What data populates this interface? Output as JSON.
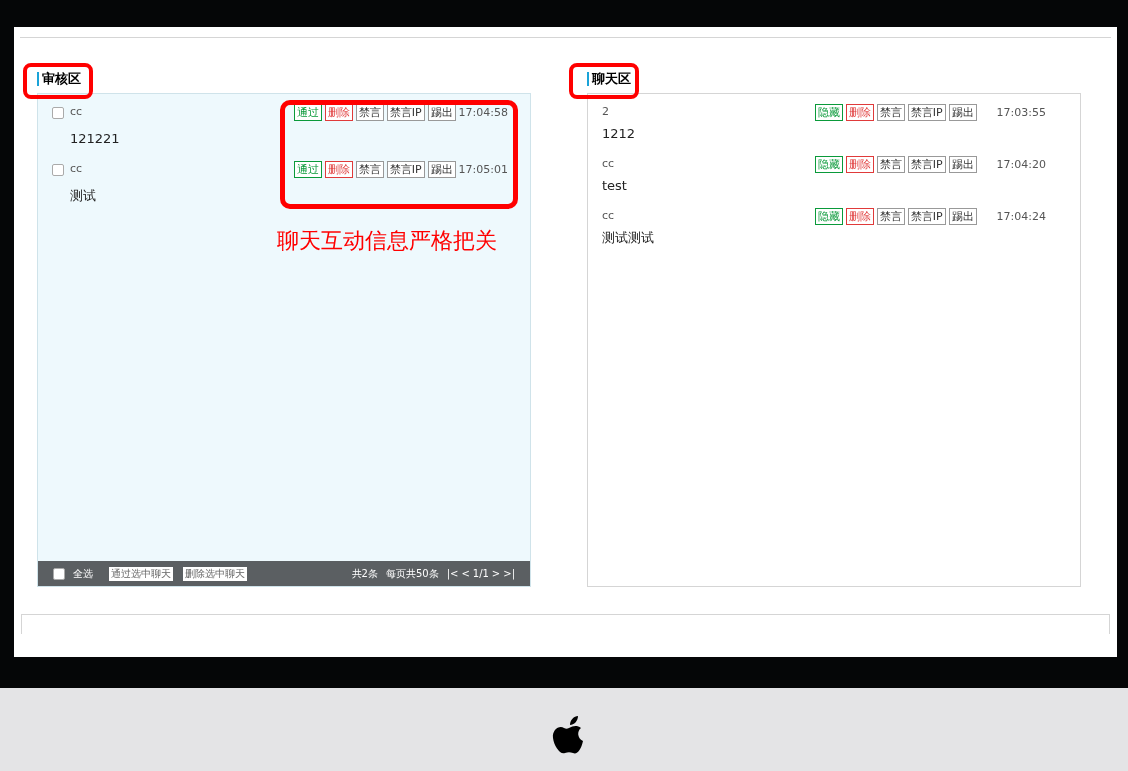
{
  "review_panel": {
    "title": "审核区",
    "rows": [
      {
        "name": "cc",
        "message": "121221",
        "checked": false,
        "time": "17:04:58",
        "actions": [
          {
            "label": "通过",
            "kind": "approve"
          },
          {
            "label": "删除",
            "kind": "delete"
          },
          {
            "label": "禁言",
            "kind": "plain"
          },
          {
            "label": "禁言IP",
            "kind": "plain"
          },
          {
            "label": "踢出",
            "kind": "plain"
          }
        ]
      },
      {
        "name": "cc",
        "message": "测试",
        "checked": false,
        "time": "17:05:01",
        "actions": [
          {
            "label": "通过",
            "kind": "approve"
          },
          {
            "label": "删除",
            "kind": "delete"
          },
          {
            "label": "禁言",
            "kind": "plain"
          },
          {
            "label": "禁言IP",
            "kind": "plain"
          },
          {
            "label": "踢出",
            "kind": "plain"
          }
        ]
      }
    ],
    "footer": {
      "select_all": {
        "label": "全选",
        "checked": false
      },
      "buttons": [
        "通过选中聊天",
        "删除选中聊天"
      ],
      "total": "共2条",
      "per_page": "每页共50条",
      "pager": [
        "|<",
        "<",
        "1/1",
        ">",
        ">|"
      ]
    }
  },
  "chat_panel": {
    "title": "聊天区",
    "rows": [
      {
        "name": "2",
        "message": "1212",
        "time": "17:03:55",
        "actions": [
          {
            "label": "隐藏",
            "kind": "approve"
          },
          {
            "label": "删除",
            "kind": "delete"
          },
          {
            "label": "禁言",
            "kind": "plain"
          },
          {
            "label": "禁言IP",
            "kind": "plain"
          },
          {
            "label": "踢出",
            "kind": "plain"
          }
        ]
      },
      {
        "name": "cc",
        "message": "test",
        "time": "17:04:20",
        "actions": [
          {
            "label": "隐藏",
            "kind": "approve"
          },
          {
            "label": "删除",
            "kind": "delete"
          },
          {
            "label": "禁言",
            "kind": "plain"
          },
          {
            "label": "禁言IP",
            "kind": "plain"
          },
          {
            "label": "踢出",
            "kind": "plain"
          }
        ]
      },
      {
        "name": "cc",
        "message": "测试测试",
        "time": "17:04:24",
        "actions": [
          {
            "label": "隐藏",
            "kind": "approve"
          },
          {
            "label": "删除",
            "kind": "delete"
          },
          {
            "label": "禁言",
            "kind": "plain"
          },
          {
            "label": "禁言IP",
            "kind": "plain"
          },
          {
            "label": "踢出",
            "kind": "plain"
          }
        ]
      }
    ]
  },
  "annotation": "聊天互动信息严格把关"
}
